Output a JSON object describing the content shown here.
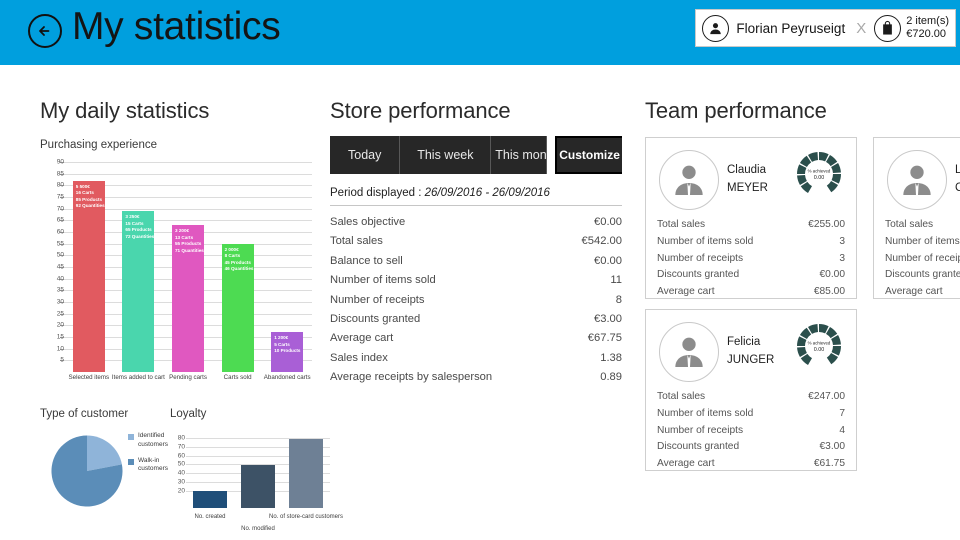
{
  "header": {
    "back_icon": "back-arrow-icon",
    "title": "My statistics",
    "user": {
      "avatar_icon": "person-icon",
      "name": "Florian Peyruseigt",
      "close_label": "X",
      "bag_icon": "shopping-bag-icon",
      "cart_items": "2 item(s)",
      "cart_total": "€720.00"
    },
    "bg_color": "#009fde"
  },
  "daily": {
    "title": "My daily statistics",
    "chart_subtitle": "Purchasing experience",
    "type_of_customer_title": "Type of customer",
    "loyalty_title": "Loyalty"
  },
  "store": {
    "title": "Store performance",
    "tabs": [
      {
        "label": "Today",
        "selected": false
      },
      {
        "label": "This week",
        "selected": false
      },
      {
        "label": "This montl",
        "selected": false
      }
    ],
    "customize_label": "Customize",
    "period_label": "Period displayed :",
    "period_value": "26/09/2016 - 26/09/2016",
    "stats": [
      {
        "label": "Sales objective",
        "value": "€0.00"
      },
      {
        "label": "Total sales",
        "value": "€542.00"
      },
      {
        "label": "Balance to sell",
        "value": "€0.00"
      },
      {
        "label": "Number of items sold",
        "value": "11"
      },
      {
        "label": "Number of receipts",
        "value": "8"
      },
      {
        "label": "Discounts granted",
        "value": "€3.00"
      },
      {
        "label": "Average cart",
        "value": "€67.75"
      },
      {
        "label": "Sales index",
        "value": "1.38"
      },
      {
        "label": "Average receipts by salesperson",
        "value": "0.89"
      }
    ]
  },
  "team": {
    "title": "Team performance",
    "gauge_caption": "% achieved",
    "gauge_value": "0.00",
    "gauge_color": "#2b4f4c",
    "cards": [
      {
        "first_name": "Claudia",
        "last_name": "MEYER",
        "avatar_icon": "person-icon",
        "stats": [
          {
            "label": "Total sales",
            "value": "€255.00"
          },
          {
            "label": "Number of items sold",
            "value": "3"
          },
          {
            "label": "Number of receipts",
            "value": "3"
          },
          {
            "label": "Discounts granted",
            "value": "€0.00"
          },
          {
            "label": "Average cart",
            "value": "€85.00"
          }
        ]
      },
      {
        "first_name": "Felicia",
        "last_name": "JUNGER",
        "avatar_icon": "person-icon",
        "stats": [
          {
            "label": "Total sales",
            "value": "€247.00"
          },
          {
            "label": "Number of items sold",
            "value": "7"
          },
          {
            "label": "Number of receipts",
            "value": "4"
          },
          {
            "label": "Discounts granted",
            "value": "€3.00"
          },
          {
            "label": "Average cart",
            "value": "€61.75"
          }
        ]
      },
      {
        "first_name": "Laetitia",
        "last_name": "CASTA",
        "avatar_icon": "person-icon",
        "stats": [
          {
            "label": "Total sales",
            "value": ""
          },
          {
            "label": "Number of items sold",
            "value": ""
          },
          {
            "label": "Number of receipts",
            "value": ""
          },
          {
            "label": "Discounts granted",
            "value": ""
          },
          {
            "label": "Average cart",
            "value": ""
          }
        ]
      }
    ]
  },
  "chart_data": [
    {
      "type": "bar",
      "title": "Purchasing experience",
      "categories": [
        "Selected items",
        "Items added to cart",
        "Pending carts",
        "Carts sold",
        "Abandoned carts"
      ],
      "values": [
        82,
        69,
        63,
        55,
        17
      ],
      "colors": [
        "#e15a60",
        "#4ad6ad",
        "#e058c0",
        "#4ddb52",
        "#a95fd6"
      ],
      "bar_labels": [
        [
          "5 500€",
          "16 Carts",
          "85 Products",
          "92 Quantities"
        ],
        [
          "3 250€",
          "15 Carts",
          "65 Products",
          "72 Quantities"
        ],
        [
          "3 200€",
          "13 Carts",
          "55 Products",
          "71 Quantities"
        ],
        [
          "2 000€",
          "8 Carts",
          "45 Products",
          "46 Quantities"
        ],
        [
          "1 200€",
          "5 Carts",
          "10 Products"
        ]
      ],
      "xlabel": "",
      "ylabel": "",
      "ylim": [
        0,
        90
      ],
      "yticks": [
        5,
        10,
        15,
        20,
        25,
        30,
        35,
        40,
        45,
        50,
        55,
        60,
        65,
        70,
        75,
        80,
        85,
        90
      ],
      "grid": true,
      "legend": "none"
    },
    {
      "type": "pie",
      "title": "Type of customer",
      "labels": [
        "Identified customers",
        "Walk-in customers"
      ],
      "values": [
        22,
        78
      ],
      "colors": [
        "#8fb4d9",
        "#5b8db8"
      ],
      "legend": "right"
    },
    {
      "type": "bar",
      "title": "Loyalty",
      "categories": [
        "No. created",
        "No. modified",
        "No. of store-card customers"
      ],
      "values": [
        19,
        49.5,
        79.5
      ],
      "colors": [
        "#1f4e79",
        "#3d5266",
        "#6e8095"
      ],
      "xlabel": "",
      "ylabel": "",
      "ylim": [
        0,
        85
      ],
      "yticks": [
        20,
        30,
        40,
        50,
        60,
        70,
        80
      ],
      "grid": true,
      "legend": "none"
    }
  ]
}
